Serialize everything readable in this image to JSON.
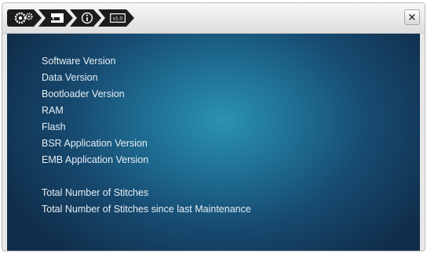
{
  "toolbar": {
    "breadcrumbs": [
      {
        "icon": "gears-icon"
      },
      {
        "icon": "sewing-machine-icon"
      },
      {
        "icon": "info-icon"
      },
      {
        "icon": "version-icon",
        "label": "v1.0"
      }
    ],
    "close_label": "×"
  },
  "info": {
    "lines": [
      "Software Version",
      "Data Version",
      "Bootloader Version",
      "RAM",
      "Flash",
      "BSR Application Version",
      "EMB Application Version"
    ],
    "stitch_lines": [
      "Total Number of Stitches",
      "Total Number of Stitches since last Maintenance"
    ]
  },
  "colors": {
    "panel_center": "#2a93b0",
    "panel_edge": "#102e4b",
    "crumb_bg": "#1c1c1c",
    "text": "#e6eef3"
  }
}
